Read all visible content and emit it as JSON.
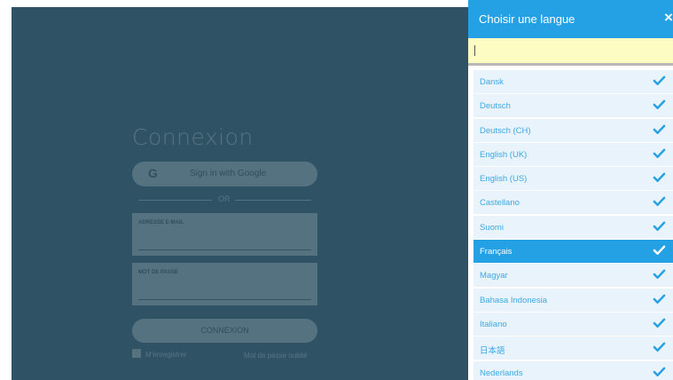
{
  "login": {
    "title": "Connexion",
    "google_label": "Sign in with Google",
    "google_glyph": "G",
    "divider_text": "OR",
    "email_label": "ADRESSE E-MAIL",
    "password_label": "MOT DE PASSE",
    "submit_label": "CONNEXION",
    "remember_label": "M'enregistrer",
    "forgot_label": "Mot de passe oublié"
  },
  "language_panel": {
    "title": "Choisir une langue",
    "close_glyph": "×",
    "search_value": "",
    "items": [
      {
        "label": "Dansk",
        "selected": false
      },
      {
        "label": "Deutsch",
        "selected": false
      },
      {
        "label": "Deutsch (CH)",
        "selected": false
      },
      {
        "label": "English (UK)",
        "selected": false
      },
      {
        "label": "English (US)",
        "selected": false
      },
      {
        "label": "Castellano",
        "selected": false
      },
      {
        "label": "Suomi",
        "selected": false
      },
      {
        "label": "Français",
        "selected": true
      },
      {
        "label": "Magyar",
        "selected": false
      },
      {
        "label": "Bahasa Indonesia",
        "selected": false
      },
      {
        "label": "Italiano",
        "selected": false
      },
      {
        "label": "日本語",
        "selected": false
      },
      {
        "label": "Nederlands",
        "selected": false
      }
    ]
  },
  "colors": {
    "backdrop": "#2f5365",
    "accent": "#24a0e4",
    "search_bg": "#fdfdc3",
    "row_bg": "#e8f3fb"
  },
  "icons": {
    "check": "check-icon",
    "close": "close-icon",
    "google": "google-icon",
    "checkbox": "checkbox-icon"
  }
}
